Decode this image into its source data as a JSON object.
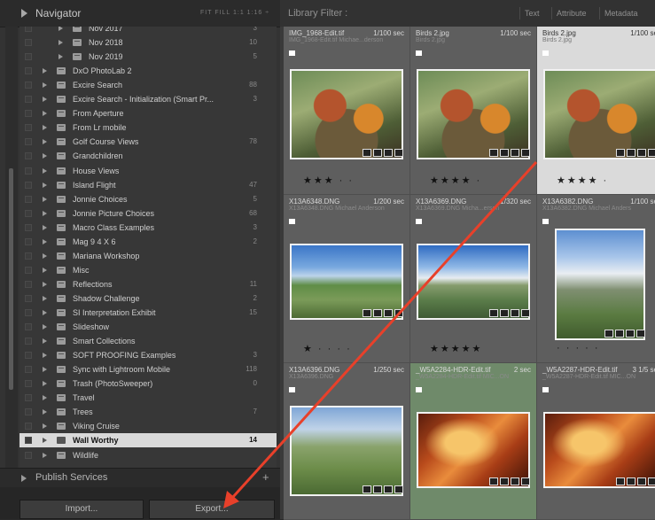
{
  "navigator": {
    "title": "Navigator",
    "zoom_options": "FIT  FILL  1:1  1:16 ÷"
  },
  "collections": [
    {
      "label": "Nov 2017",
      "count": "3",
      "indent": 2
    },
    {
      "label": "Nov 2018",
      "count": "10",
      "indent": 2
    },
    {
      "label": "Nov 2019",
      "count": "5",
      "indent": 2
    },
    {
      "label": "DxO PhotoLab 2",
      "count": "",
      "indent": 1
    },
    {
      "label": "Excire Search",
      "count": "88",
      "indent": 1
    },
    {
      "label": "Excire Search - Initialization (Smart Pr...",
      "count": "3",
      "indent": 1
    },
    {
      "label": "From Aperture",
      "count": "",
      "indent": 1
    },
    {
      "label": "From Lr mobile",
      "count": "",
      "indent": 1
    },
    {
      "label": "Golf Course Views",
      "count": "78",
      "indent": 1
    },
    {
      "label": "Grandchildren",
      "count": "",
      "indent": 1
    },
    {
      "label": "House Views",
      "count": "",
      "indent": 1
    },
    {
      "label": "Island Flight",
      "count": "47",
      "indent": 1
    },
    {
      "label": "Jonnie Choices",
      "count": "5",
      "indent": 1
    },
    {
      "label": "Jonnie Picture Choices",
      "count": "68",
      "indent": 1
    },
    {
      "label": "Macro Class Examples",
      "count": "3",
      "indent": 1
    },
    {
      "label": "Mag 9 4 X 6",
      "count": "2",
      "indent": 1
    },
    {
      "label": "Mariana Workshop",
      "count": "",
      "indent": 1
    },
    {
      "label": "Misc",
      "count": "",
      "indent": 1
    },
    {
      "label": "Reflections",
      "count": "11",
      "indent": 1
    },
    {
      "label": "Shadow Challenge",
      "count": "2",
      "indent": 1
    },
    {
      "label": "SI Interpretation Exhibit",
      "count": "15",
      "indent": 1
    },
    {
      "label": "Slideshow",
      "count": "",
      "indent": 1
    },
    {
      "label": "Smart Collections",
      "count": "",
      "indent": 1
    },
    {
      "label": "SOFT PROOFING Examples",
      "count": "3",
      "indent": 1
    },
    {
      "label": "Sync with Lightroom Mobile",
      "count": "118",
      "indent": 1
    },
    {
      "label": "Trash (PhotoSweeper)",
      "count": "0",
      "indent": 1
    },
    {
      "label": "Travel",
      "count": "",
      "indent": 1
    },
    {
      "label": "Trees",
      "count": "7",
      "indent": 1
    },
    {
      "label": "Viking Cruise",
      "count": "",
      "indent": 1
    },
    {
      "label": "Wall Worthy",
      "count": "14",
      "indent": 1,
      "selected": true
    },
    {
      "label": "Wildlife",
      "count": "",
      "indent": 1
    }
  ],
  "publish_services": {
    "label": "Publish Services",
    "plus": "+"
  },
  "buttons": {
    "import": "Import...",
    "export": "Export..."
  },
  "filter_bar": {
    "title": "Library Filter :",
    "tabs": [
      "Text",
      "Attribute",
      "Metadata"
    ]
  },
  "grid": [
    {
      "file": "IMG_1968-Edit.tif",
      "shutter": "1/100 sec",
      "meta": "IMG_1968-Edit.tif   Michae...derson",
      "stars": "★★★ · ·",
      "photo": "bird",
      "style": "dark"
    },
    {
      "file": "Birds 2.jpg",
      "shutter": "1/100 sec",
      "meta": "Birds 2.jpg",
      "stars": "★★★★ ·",
      "photo": "bird",
      "style": "dark"
    },
    {
      "file": "Birds 2.jpg",
      "shutter": "1/100 se",
      "meta": "Birds 2.jpg",
      "stars": "★★★★ ·",
      "photo": "bird",
      "style": "light"
    },
    {
      "file": "X13A6348.DNG",
      "shutter": "1/200 sec",
      "meta": "X13A6348.DNG   Michael Anderson",
      "stars": "★ · · · ·",
      "photo": "lake1",
      "style": "dark"
    },
    {
      "file": "X13A6369.DNG",
      "shutter": "1/320 sec",
      "meta": "X13A6369.DNG   Micha...erson",
      "stars": "★★★★★",
      "photo": "lake2",
      "style": "dark"
    },
    {
      "file": "X13A6382.DNG",
      "shutter": "1/100 se",
      "meta": "X13A6382.DNG   Michael Anders",
      "stars": "· · · · ·",
      "photo": "lake3",
      "style": "dark"
    },
    {
      "file": "X13A6396.DNG",
      "shutter": "1/250 sec",
      "meta": "X13A6396.DNG",
      "stars": "",
      "photo": "valley",
      "style": "dark"
    },
    {
      "file": "_W5A2284-HDR-Edit.tif",
      "shutter": "2 sec",
      "meta": "_W5A2284-HDR-Edit.tif   MIC...ON",
      "stars": "",
      "photo": "canyon",
      "style": "green"
    },
    {
      "file": "_W5A2287-HDR-Edit.tif",
      "shutter": "3 1/5 se",
      "meta": "_W5A2287-HDR-Edit.tif   MIC...ON",
      "stars": "",
      "photo": "canyon",
      "style": "dark"
    }
  ]
}
